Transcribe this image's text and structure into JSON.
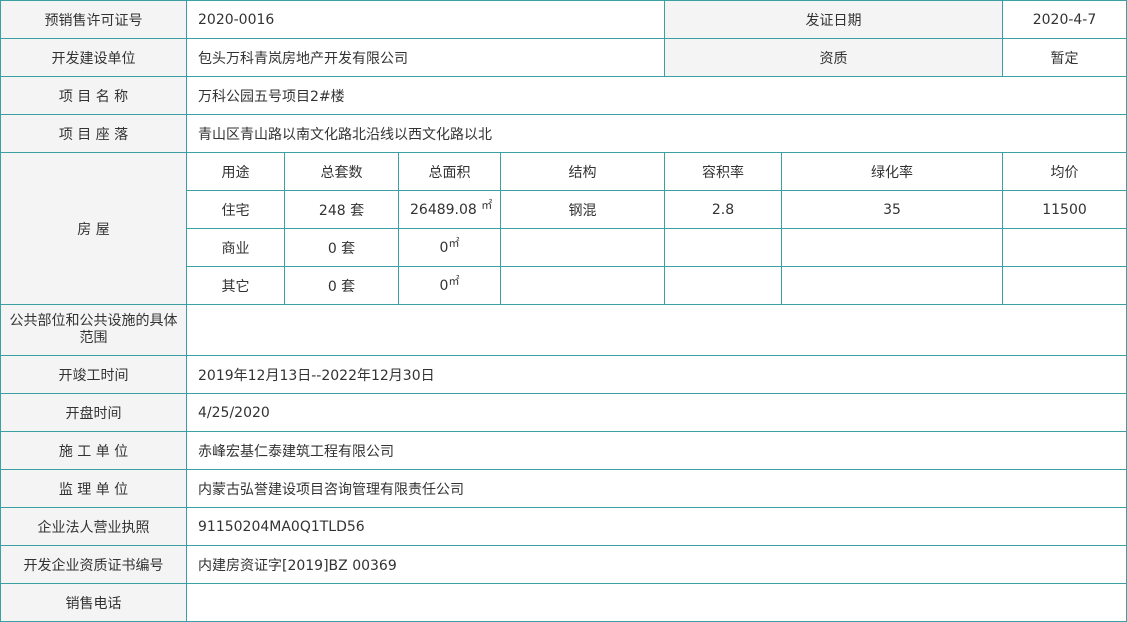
{
  "license": {
    "label": "预销售许可证号",
    "value": "2020-0016",
    "issue_date_label": "发证日期",
    "issue_date": "2020-4-7"
  },
  "developer": {
    "label": "开发建设单位",
    "value": "包头万科青岚房地产开发有限公司",
    "qualification_label": "资质",
    "qualification": "暂定"
  },
  "project_name": {
    "label": "项 目 名 称",
    "value": "万科公园五号项目2#楼"
  },
  "project_location": {
    "label": "项 目 座 落",
    "value": "青山区青山路以南文化路北沿线以西文化路以北"
  },
  "housing": {
    "label": "房 屋",
    "headers": [
      "用途",
      "总套数",
      "总面积",
      "结构",
      "容积率",
      "绿化率",
      "均价"
    ],
    "area_unit": "㎡",
    "rows": [
      {
        "use": "住宅",
        "units": "248 套",
        "area": "26489.08 ",
        "structure": "钢混",
        "plot_ratio": "2.8",
        "green_ratio": "35",
        "avg_price": "11500"
      },
      {
        "use": "商业",
        "units": "0 套",
        "area": "0",
        "structure": "",
        "plot_ratio": "",
        "green_ratio": "",
        "avg_price": ""
      },
      {
        "use": "其它",
        "units": "0 套",
        "area": "0",
        "structure": "",
        "plot_ratio": "",
        "green_ratio": "",
        "avg_price": ""
      }
    ]
  },
  "public_facilities": {
    "label": "公共部位和公共设施的具体范围",
    "value": ""
  },
  "construction_period": {
    "label": "开竣工时间",
    "value": "2019年12月13日--2022年12月30日"
  },
  "opening_time": {
    "label": "开盘时间",
    "value": "4/25/2020"
  },
  "contractor": {
    "label": "施 工 单 位",
    "value": "赤峰宏基仁泰建筑工程有限公司"
  },
  "supervisor": {
    "label": "监 理 单 位",
    "value": "内蒙古弘誉建设项目咨询管理有限责任公司"
  },
  "business_license": {
    "label": "企业法人营业执照",
    "value": "91150204MA0Q1TLD56"
  },
  "qualification_cert": {
    "label": "开发企业资质证书编号",
    "value": "内建房资证字[2019]BZ 00369"
  },
  "sales_phone": {
    "label": "销售电话",
    "value": ""
  }
}
